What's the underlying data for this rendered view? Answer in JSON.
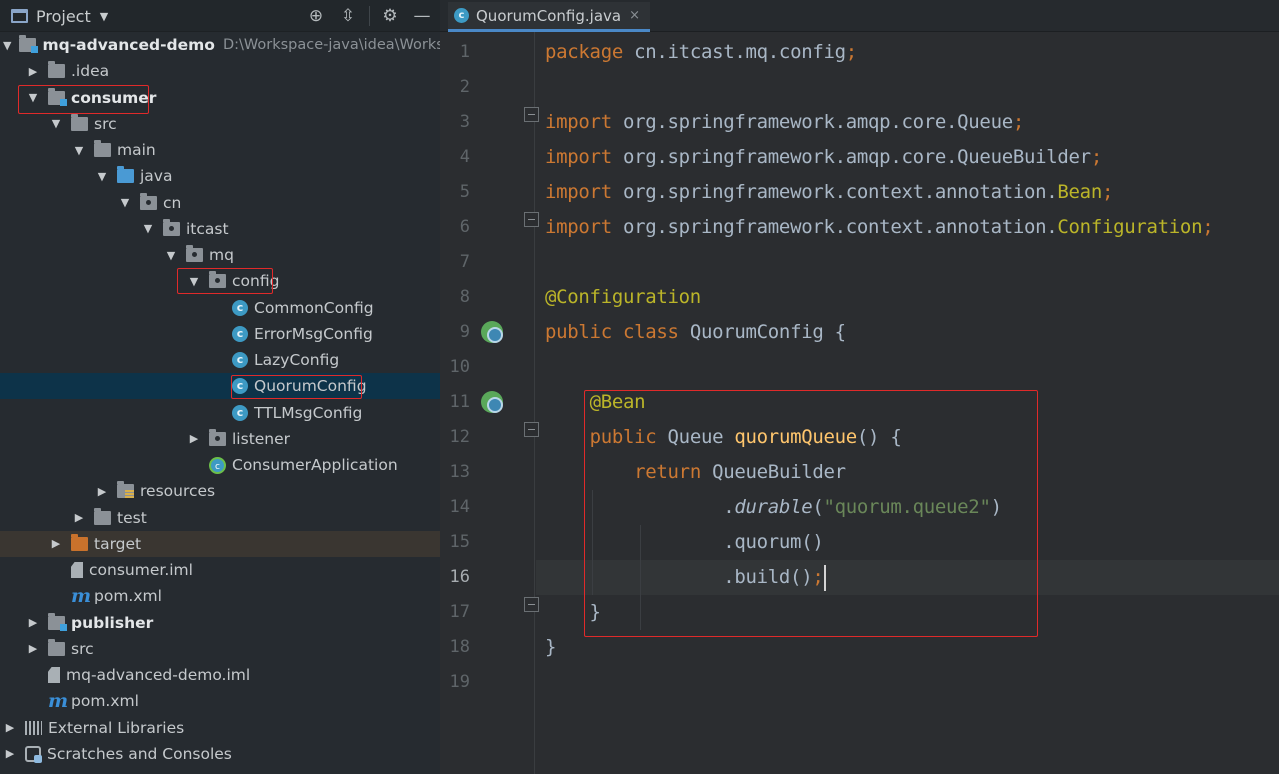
{
  "project_panel": {
    "title": "Project",
    "tree": [
      {
        "label": "mq-advanced-demo",
        "hint": "D:\\Workspace-java\\idea\\Worksp",
        "depth": 0,
        "expanded": true,
        "icon": "module-folder-icon",
        "bold": true
      },
      {
        "label": ".idea",
        "depth": 1,
        "expanded": false,
        "icon": "folder-icon"
      },
      {
        "label": "consumer",
        "depth": 1,
        "expanded": true,
        "icon": "module-folder-icon",
        "bold": true
      },
      {
        "label": "src",
        "depth": 2,
        "expanded": true,
        "icon": "folder-icon"
      },
      {
        "label": "main",
        "depth": 3,
        "expanded": true,
        "icon": "folder-icon"
      },
      {
        "label": "java",
        "depth": 4,
        "expanded": true,
        "icon": "source-folder-icon"
      },
      {
        "label": "cn",
        "depth": 5,
        "expanded": true,
        "icon": "package-icon"
      },
      {
        "label": "itcast",
        "depth": 6,
        "expanded": true,
        "icon": "package-icon"
      },
      {
        "label": "mq",
        "depth": 7,
        "expanded": true,
        "icon": "package-icon"
      },
      {
        "label": "config",
        "depth": 8,
        "expanded": true,
        "icon": "package-icon"
      },
      {
        "label": "CommonConfig",
        "depth": 9,
        "icon": "java-class-icon"
      },
      {
        "label": "ErrorMsgConfig",
        "depth": 9,
        "icon": "java-class-icon"
      },
      {
        "label": "LazyConfig",
        "depth": 9,
        "icon": "java-class-icon"
      },
      {
        "label": "QuorumConfig",
        "depth": 9,
        "icon": "java-class-icon",
        "selected": true
      },
      {
        "label": "TTLMsgConfig",
        "depth": 9,
        "icon": "java-class-icon"
      },
      {
        "label": "listener",
        "depth": 8,
        "expanded": false,
        "icon": "package-icon"
      },
      {
        "label": "ConsumerApplication",
        "depth": 8,
        "icon": "spring-boot-class-icon"
      },
      {
        "label": "resources",
        "depth": 4,
        "expanded": false,
        "icon": "resources-folder-icon"
      },
      {
        "label": "test",
        "depth": 3,
        "expanded": false,
        "icon": "folder-icon"
      },
      {
        "label": "target",
        "depth": 2,
        "expanded": false,
        "icon": "excluded-folder-icon"
      },
      {
        "label": "consumer.iml",
        "depth": 2,
        "icon": "iml-file-icon"
      },
      {
        "label": "pom.xml",
        "depth": 2,
        "icon": "maven-icon"
      },
      {
        "label": "publisher",
        "depth": 1,
        "expanded": false,
        "icon": "module-folder-icon",
        "bold": true
      },
      {
        "label": "src",
        "depth": 1,
        "expanded": false,
        "icon": "folder-icon"
      },
      {
        "label": "mq-advanced-demo.iml",
        "depth": 1,
        "icon": "iml-file-icon"
      },
      {
        "label": "pom.xml",
        "depth": 1,
        "icon": "maven-icon"
      },
      {
        "label": "External Libraries",
        "depth": 0,
        "expanded": false,
        "icon": "libraries-icon"
      },
      {
        "label": "Scratches and Consoles",
        "depth": 0,
        "expanded": false,
        "icon": "scratches-icon"
      }
    ]
  },
  "editor": {
    "tab_label": "QuorumConfig.java",
    "tab_close": "×",
    "active_line": 16,
    "lines": [
      {
        "n": "1",
        "tokens": [
          {
            "t": "package ",
            "c": "kw"
          },
          {
            "t": "cn.itcast.mq.config"
          },
          {
            "t": ";",
            "c": "kw"
          }
        ]
      },
      {
        "n": "2",
        "tokens": []
      },
      {
        "n": "3",
        "tokens": [
          {
            "t": "import ",
            "c": "kw"
          },
          {
            "t": "org.springframework.amqp.core.Queue"
          },
          {
            "t": ";",
            "c": "kw"
          }
        ]
      },
      {
        "n": "4",
        "tokens": [
          {
            "t": "import ",
            "c": "kw"
          },
          {
            "t": "org.springframework.amqp.core.QueueBuilder"
          },
          {
            "t": ";",
            "c": "kw"
          }
        ]
      },
      {
        "n": "5",
        "tokens": [
          {
            "t": "import ",
            "c": "kw"
          },
          {
            "t": "org.springframework.context.annotation."
          },
          {
            "t": "Bean",
            "c": "an"
          },
          {
            "t": ";",
            "c": "kw"
          }
        ]
      },
      {
        "n": "6",
        "tokens": [
          {
            "t": "import ",
            "c": "kw"
          },
          {
            "t": "org.springframework.context.annotation."
          },
          {
            "t": "Configuration",
            "c": "an"
          },
          {
            "t": ";",
            "c": "kw"
          }
        ]
      },
      {
        "n": "7",
        "tokens": []
      },
      {
        "n": "8",
        "tokens": [
          {
            "t": "@Configuration",
            "c": "an"
          }
        ]
      },
      {
        "n": "9",
        "tokens": [
          {
            "t": "public class ",
            "c": "kw"
          },
          {
            "t": "QuorumConfig {"
          }
        ]
      },
      {
        "n": "10",
        "tokens": []
      },
      {
        "n": "11",
        "tokens": [
          {
            "t": "    "
          },
          {
            "t": "@Bean",
            "c": "an"
          }
        ]
      },
      {
        "n": "12",
        "tokens": [
          {
            "t": "    "
          },
          {
            "t": "public ",
            "c": "kw"
          },
          {
            "t": "Queue "
          },
          {
            "t": "quorumQueue",
            "c": "fn"
          },
          {
            "t": "() {"
          }
        ]
      },
      {
        "n": "13",
        "tokens": [
          {
            "t": "        "
          },
          {
            "t": "return ",
            "c": "kw"
          },
          {
            "t": "QueueBuilder"
          }
        ]
      },
      {
        "n": "14",
        "tokens": [
          {
            "t": "                ."
          },
          {
            "t": "durable",
            "c": "it"
          },
          {
            "t": "("
          },
          {
            "t": "\"quorum.queue2\"",
            "c": "st"
          },
          {
            "t": ")"
          }
        ]
      },
      {
        "n": "15",
        "tokens": [
          {
            "t": "                .quorum()"
          }
        ]
      },
      {
        "n": "16",
        "tokens": [
          {
            "t": "                .build()"
          },
          {
            "t": ";",
            "c": "kw"
          }
        ]
      },
      {
        "n": "17",
        "tokens": [
          {
            "t": "    }"
          }
        ]
      },
      {
        "n": "18",
        "tokens": [
          {
            "t": "}"
          }
        ]
      },
      {
        "n": "19",
        "tokens": []
      }
    ]
  },
  "colors": {
    "keyword": "#cc7832",
    "annotation": "#bbb529",
    "method": "#ffc66d",
    "string": "#6a8759",
    "plain": "#a9b7c6",
    "highlight_box": "#e02a2a",
    "selection": "#0d3349"
  }
}
